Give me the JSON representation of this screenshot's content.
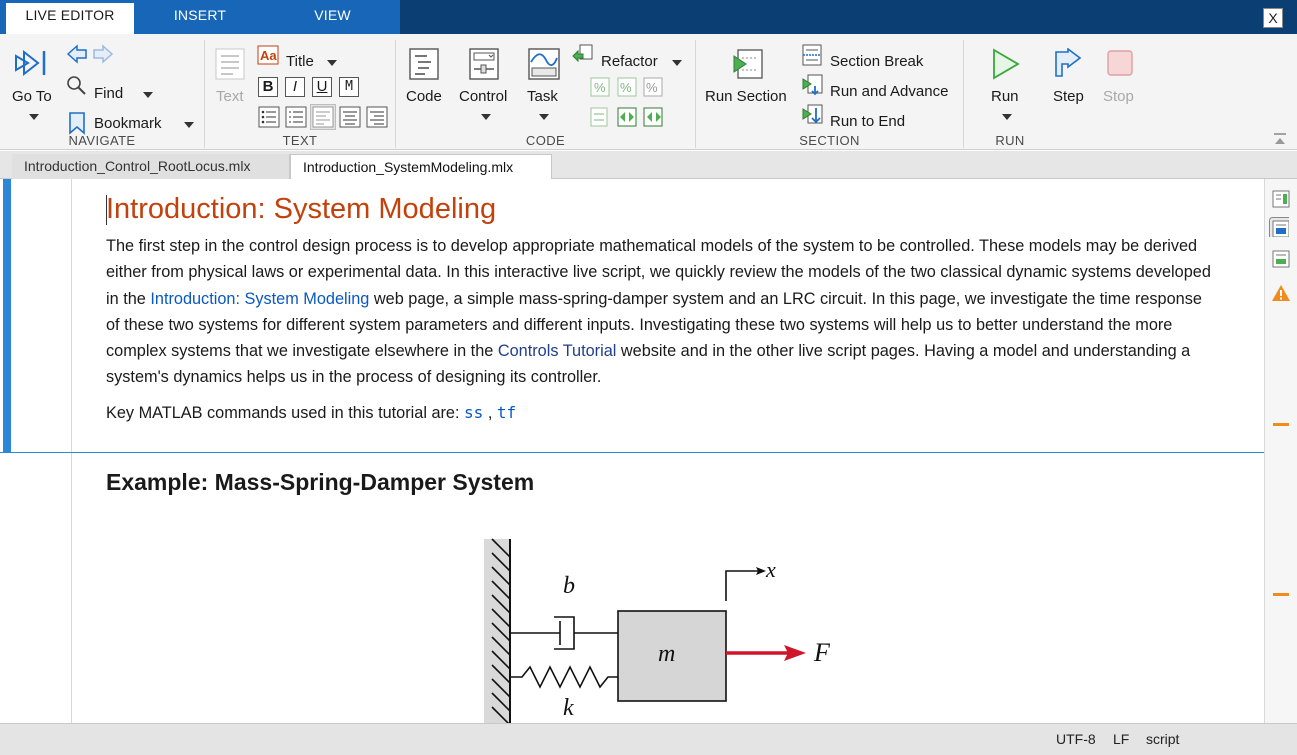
{
  "toolstrip": {
    "tabs": [
      "LIVE EDITOR",
      "INSERT",
      "VIEW"
    ],
    "close_label": "X"
  },
  "navigate": {
    "label": "NAVIGATE",
    "goto": "Go To",
    "find": "Find",
    "bookmark": "Bookmark"
  },
  "text_group": {
    "label": "TEXT",
    "text": "Text",
    "title": "Title",
    "bold": "B",
    "italic": "I",
    "underline": "U",
    "mono": "M"
  },
  "code_group": {
    "label": "CODE",
    "code": "Code",
    "control": "Control",
    "task": "Task",
    "refactor": "Refactor"
  },
  "section_group": {
    "label": "SECTION",
    "run_section": "Run Section",
    "section_break": "Section Break",
    "run_and_advance": "Run and Advance",
    "run_to_end": "Run to End"
  },
  "run_group": {
    "label": "RUN",
    "run": "Run",
    "step": "Step",
    "stop": "Stop"
  },
  "doc_tabs": [
    "Introduction_Control_RootLocus.mlx",
    "Introduction_SystemModeling.mlx"
  ],
  "document": {
    "title": "Introduction: System Modeling",
    "p1_a": "The first step in the control design process is to develop appropriate mathematical models of the system to be controlled. These models may be derived either from physical laws or experimental data. In this interactive live script, we quickly review the models of the two classical dynamic systems developed in the ",
    "p1_link1": "Introduction: System Modeling",
    "p1_b": " web page, a simple mass-spring-damper system and an LRC circuit. In this page, we investigate the time response of these two systems for different system parameters and different inputs. Investigating these two systems will help us to better understand the more complex systems that we investigate elsewhere in the ",
    "p1_link2": "Controls Tutorial",
    "p1_c": " website and in the other live script pages. Having a model and understanding a system's dynamics helps us in the process of designing its controller.",
    "key_prefix": "Key MATLAB commands used in this tutorial are: ",
    "cmd1": "ss",
    "sep": " , ",
    "cmd2": "tf",
    "h2": "Example: Mass-Spring-Damper System"
  },
  "figure": {
    "damper_label": "b",
    "spring_label": "k",
    "mass_label": "m",
    "force_label": "F",
    "position_label": "x",
    "force_color": "#d0152a"
  },
  "status": {
    "encoding": "UTF-8",
    "line_ending": "LF",
    "mode": "script"
  }
}
